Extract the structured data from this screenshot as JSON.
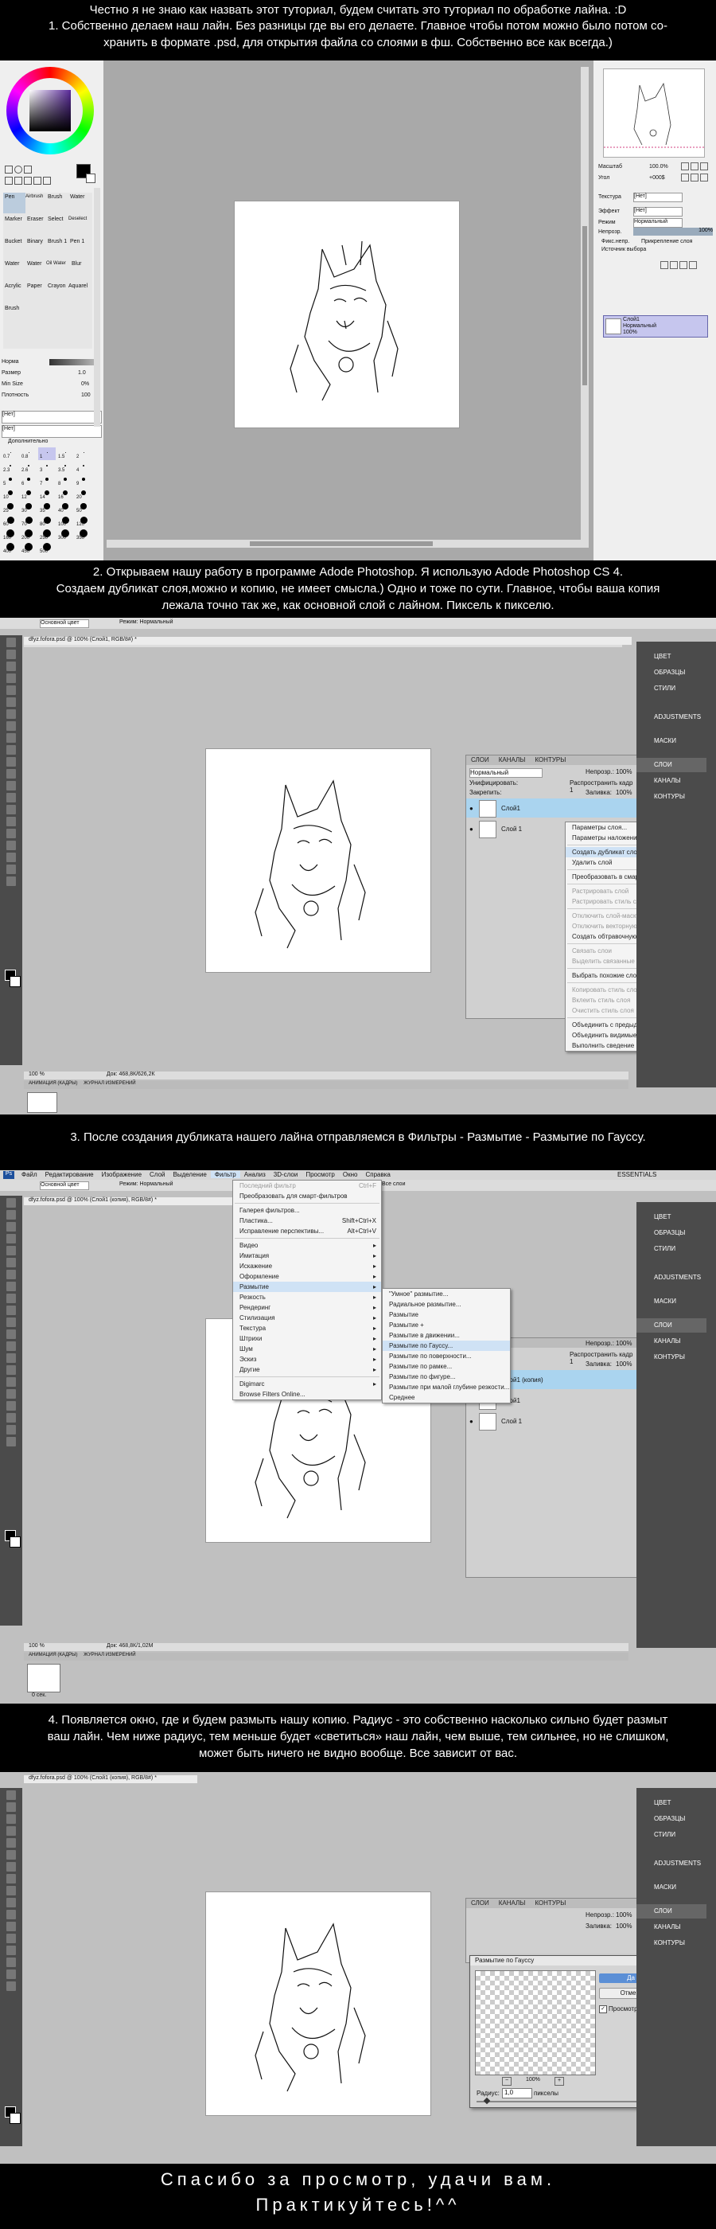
{
  "captions": {
    "c1a": "Честно я не знаю как назвать этот туториал, будем считать это туториал по обработке  лайна. :D",
    "c1b": "1. Собственно делаем наш лайн. Без разницы где вы его делаете. Главное чтобы потом можно было потом со-",
    "c1c": "хранить в формате .psd, для открытия файла со слоями в фш. Собственно все как всегда.)",
    "c2a": "2. Открываем нашу работу в программе Adode Photoshop. Я использую Adode Photoshop CS 4.",
    "c2b": "Создаем дубликат слоя,можно и копию, не имеет смысла.) Одно и тоже по сути. Главное, чтобы ваша копия",
    "c2c": "лежала точно так же, как основной слой с лайном. Пиксель к пикселю.",
    "c3": "3. После создания дубликата нашего лайна отправляемся в Фильтры - Размытие - Размытие по Гауссу.",
    "c4a": "4. Появляется окно, где и будем размыть нашу копию. Радиус - это собственно насколько сильно будет размыт",
    "c4b": "ваш лайн.  Чем ниже радиус, тем меньше будет «светиться» наш лайн, чем выше, тем сильнее, но не слишком,",
    "c4c": "может быть ничего не видно вообще. Все зависит от вас.",
    "end1": "Спасибо за просмотр, удачи вам.",
    "end2": "Практикуйтесь!^^"
  },
  "sai": {
    "tools": [
      "Pen",
      "Airbrush",
      "Brush",
      "Water",
      "Marker",
      "Eraser",
      "Select",
      "Deselect",
      "Bucket",
      "Binary",
      "Brush 1",
      "Pen 1",
      "Water",
      "Water",
      "Oil Water",
      "Blur",
      "Acrylic",
      "Paper",
      "Crayon",
      "Aquarel",
      "Brush"
    ],
    "settings": [
      {
        "label": "Норма",
        "value": ""
      },
      {
        "label": "Размер",
        "value": "1.0"
      },
      {
        "label": "Min Size",
        "value": "0%"
      },
      {
        "label": "Плотность",
        "value": "100"
      }
    ],
    "labels": {
      "pattern": "[Нет]",
      "texture": "[Нет]",
      "advanced": "Дополнительно"
    },
    "sizes": [
      "0.7",
      "0.8",
      "1",
      "1.5",
      "2",
      "2.3",
      "2.6",
      "3",
      "3.5",
      "4",
      "5",
      "6",
      "7",
      "8",
      "9",
      "10",
      "12",
      "14",
      "16",
      "20",
      "25",
      "30",
      "35",
      "40",
      "50",
      "60",
      "70",
      "80",
      "100",
      "120",
      "160",
      "200",
      "250",
      "300",
      "350",
      "400",
      "450",
      "500"
    ],
    "nav": {
      "zoom_label": "Масштаб",
      "zoom": "100.0%",
      "angle_label": "Угол",
      "angle": "+000$"
    },
    "layer_panel": {
      "texture_label": "Текстура",
      "texture": "[Нет]",
      "effect_label": "Эффект",
      "effect": "[Нет]",
      "mode_label": "Режим",
      "mode": "Нормальный",
      "opacity_label": "Непрозр.",
      "opacity": "100%",
      "chk1": "Фикс.непр.",
      "chk2": "Прикрепление слоя",
      "chk3": "Источник выбора"
    },
    "layer": {
      "name": "Слой1",
      "mode": "Нормальный",
      "opacity": "100%"
    }
  },
  "ps2": {
    "options_left": "Основной цвет",
    "mode": "Режим: Нормальный",
    "doc_title": "dfyz.fofora.psd @ 100% (Слой1, RGB/8#) *",
    "status": "Док: 468,8К/626,2К",
    "zoom": "100 %",
    "anim_tab": "АНИМАЦИЯ (КАДРЫ)",
    "journal_tab": "ЖУРНАЛ ИЗМЕРЕНИЙ",
    "right_panel": [
      "ЦВЕТ",
      "ОБРАЗЦЫ",
      "СТИЛИ",
      "ADJUSTMENTS",
      "МАСКИ",
      "СЛОИ",
      "КАНАЛЫ",
      "КОНТУРЫ"
    ],
    "layers": {
      "tabs": [
        "СЛОИ",
        "КАНАЛЫ",
        "КОНТУРЫ"
      ],
      "mode": "Нормальный",
      "opacity_label": "Непрозр.:",
      "opacity": "100%",
      "lock_label": "Закрепить:",
      "fill_label": "Заливка:",
      "fill": "100%",
      "unify": "Унифицировать:",
      "propagate": "Распространить кадр 1",
      "rows": [
        "Слой1",
        "Слой 1"
      ]
    },
    "context_menu": [
      "Параметры слоя...",
      "Параметры наложения...",
      "Создать дубликат слоя...",
      "Удалить слой",
      "Преобразовать в смарт-объект",
      "Растрировать слой",
      "Растрировать стиль слоя",
      "Отключить слой-маску",
      "Отключить векторную маску",
      "Создать обтравочную маску",
      "Связать слои",
      "Выделить связанные слои",
      "Выбрать похожие слои",
      "Копировать стиль слоя",
      "Вклеить стиль слоя",
      "Очистить стиль слоя",
      "Объединить с предыдущим",
      "Объединить видимые",
      "Выполнить сведение"
    ]
  },
  "ps3": {
    "menubar": [
      "Файл",
      "Редактирование",
      "Изображение",
      "Слой",
      "Выделение",
      "Фильтр",
      "Анализ",
      "3D-слои",
      "Просмотр",
      "Окно",
      "Справка"
    ],
    "workspace": "ESSENTIALS",
    "options_left": "Основной цвет",
    "mode": "Режим: Нормальный",
    "all_layers": "Все слои",
    "doc_title": "dfyz.fofora.psd @ 100% (Слой1 (копия), RGB/8#) *",
    "filter_menu": [
      {
        "t": "Последний фильтр",
        "k": "Ctrl+F",
        "dis": true
      },
      {
        "t": "Преобразовать для смарт-фильтров",
        "k": "",
        "dis": false
      },
      {
        "t": "Галерея фильтров...",
        "k": "",
        "dis": false
      },
      {
        "t": "Пластика...",
        "k": "Shift+Ctrl+X",
        "dis": false
      },
      {
        "t": "Исправление перспективы...",
        "k": "Alt+Ctrl+V",
        "dis": false
      },
      {
        "t": "Видео",
        "k": "▸",
        "dis": false
      },
      {
        "t": "Имитация",
        "k": "▸",
        "dis": false
      },
      {
        "t": "Искажение",
        "k": "▸",
        "dis": false
      },
      {
        "t": "Оформление",
        "k": "▸",
        "dis": false
      },
      {
        "t": "Размытие",
        "k": "▸",
        "dis": false,
        "hl": true
      },
      {
        "t": "Резкость",
        "k": "▸",
        "dis": false
      },
      {
        "t": "Рендеринг",
        "k": "▸",
        "dis": false
      },
      {
        "t": "Стилизация",
        "k": "▸",
        "dis": false
      },
      {
        "t": "Текстура",
        "k": "▸",
        "dis": false
      },
      {
        "t": "Штрихи",
        "k": "▸",
        "dis": false
      },
      {
        "t": "Шум",
        "k": "▸",
        "dis": false
      },
      {
        "t": "Эскиз",
        "k": "▸",
        "dis": false
      },
      {
        "t": "Другие",
        "k": "▸",
        "dis": false
      },
      {
        "t": "Digimarc",
        "k": "▸",
        "dis": false
      },
      {
        "t": "Browse Filters Online...",
        "k": "",
        "dis": false
      }
    ],
    "blur_menu": [
      "\"Умное\" размытие...",
      "Радиальное размытие...",
      "Размытие",
      "Размытие +",
      "Размытие в движении...",
      "Размытие по Гауссу...",
      "Размытие по поверхности...",
      "Размытие по рамке...",
      "Размытие по фигуре...",
      "Размытие при малой глубине резкости...",
      "Среднее"
    ],
    "layers": {
      "rows": [
        "Слой1 (копия)",
        "Слой1",
        "Слой 1"
      ]
    },
    "zoom": "100 %",
    "status": "Док: 468,8К/1,02М",
    "anim_tab": "АНИМАЦИЯ (КАДРЫ)",
    "journal_tab": "ЖУРНАЛ ИЗМЕРЕНИЙ",
    "frame_time": "0 сек."
  },
  "ps4": {
    "doc_title": "dfyz.fofora.psd @ 100% (Слой1 (копия), RGB/8#) *",
    "dialog": {
      "title": "Размытие по Гауссу",
      "ok": "Да",
      "cancel": "Отмена",
      "preview": "Просмотр",
      "zoom": "100%",
      "radius_label": "Радиус:",
      "radius": "1,0",
      "unit": "пикселы"
    }
  }
}
